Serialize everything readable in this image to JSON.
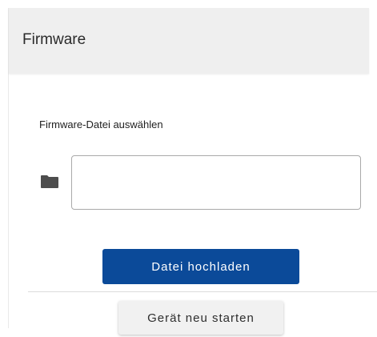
{
  "card": {
    "title": "Firmware"
  },
  "firmware": {
    "file_label": "Firmware-Datei auswählen",
    "file_value": "",
    "file_placeholder": "",
    "folder_icon": "folder-icon",
    "upload_label": "Datei hochladen",
    "restart_label": "Gerät neu starten"
  },
  "colors": {
    "primary_button": "#0b4a99",
    "secondary_button": "#f1f1f1",
    "header_background": "#efefef"
  }
}
